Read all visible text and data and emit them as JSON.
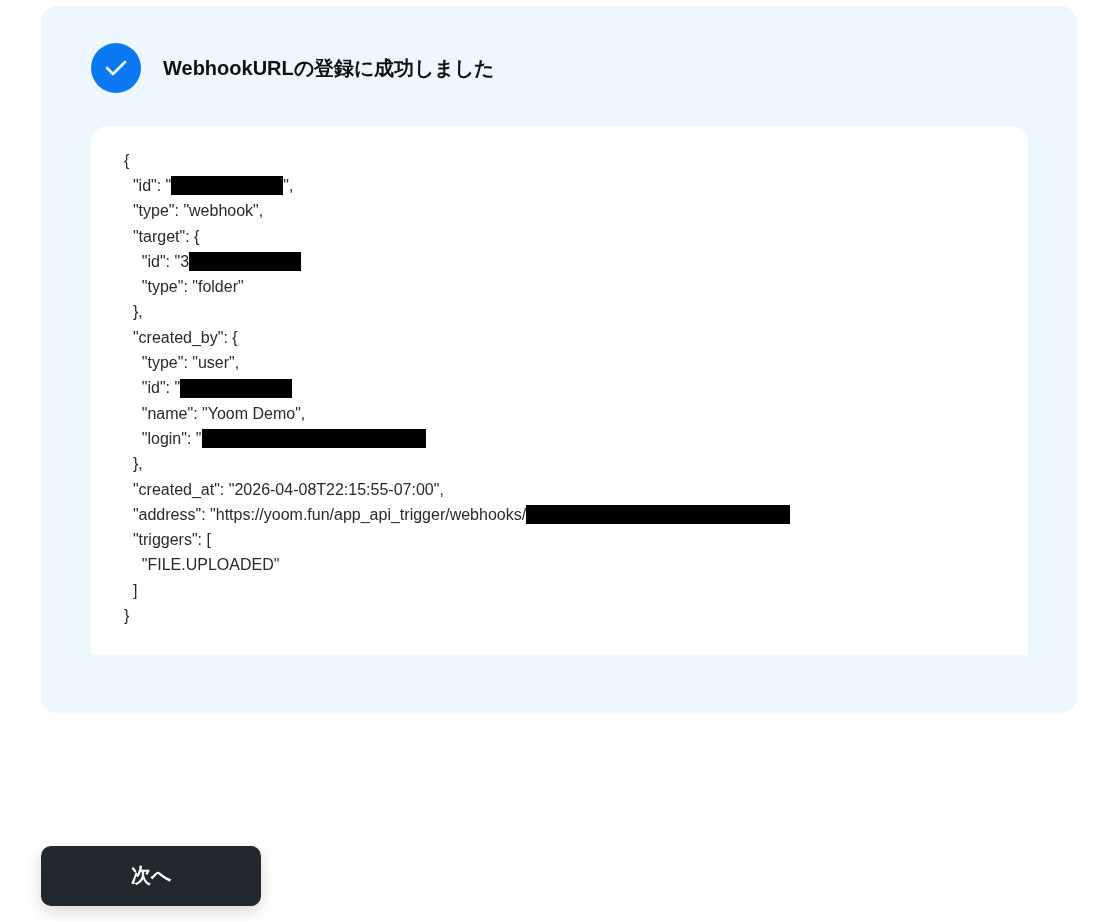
{
  "result": {
    "title": "WebhookURLの登録に成功しました",
    "kind": "success"
  },
  "response_lines": [
    {
      "text": "{",
      "kind": "plain"
    },
    {
      "text": "  \"id\": \"",
      "kind": "medium",
      "tail": "\","
    },
    {
      "text": "  \"type\": \"webhook\",",
      "kind": "plain"
    },
    {
      "text": "  \"target\": {",
      "kind": "plain"
    },
    {
      "text": "    \"id\": \"3",
      "kind": "medium"
    },
    {
      "text": "    \"type\": \"folder\"",
      "kind": "plain"
    },
    {
      "text": "  },",
      "kind": "plain"
    },
    {
      "text": "  \"created_by\": {",
      "kind": "plain"
    },
    {
      "text": "    \"type\": \"user\",",
      "kind": "plain"
    },
    {
      "text": "    \"id\": \"",
      "kind": "medium"
    },
    {
      "text": "    \"name\": \"Yoom Demo\",",
      "kind": "plain"
    },
    {
      "text": "    \"login\": \"",
      "kind": "long"
    },
    {
      "text": "  },",
      "kind": "plain"
    },
    {
      "text": "  \"created_at\": \"2026-04-08T22:15:55-07:00\",",
      "kind": "plain"
    },
    {
      "text": "  \"address\": \"https://yoom.fun/app_api_trigger/webhooks/",
      "kind": "xlong"
    },
    {
      "text": "  \"triggers\": [",
      "kind": "plain"
    },
    {
      "text": "    \"FILE.UPLOADED\"",
      "kind": "plain"
    },
    {
      "text": "  ]",
      "kind": "plain"
    },
    {
      "text": "}",
      "kind": "plain"
    }
  ],
  "next_button": "次へ"
}
